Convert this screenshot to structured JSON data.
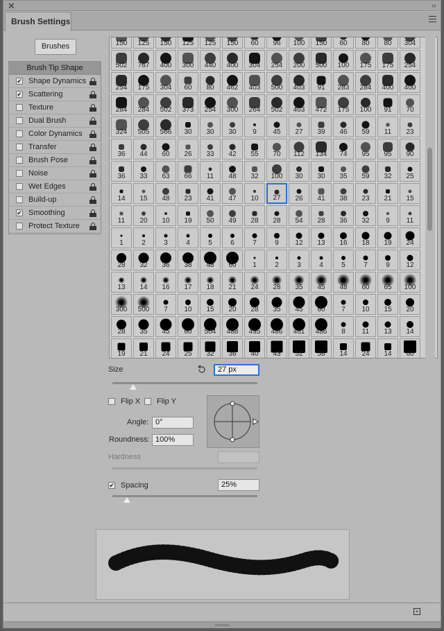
{
  "window": {
    "close_glyph": "✕",
    "collapse_glyph": "‹‹",
    "tab_title": "Brush Settings"
  },
  "left": {
    "brushes_button": "Brushes",
    "tip_shape": "Brush Tip Shape",
    "items": [
      {
        "label": "Shape Dynamics",
        "checked": true
      },
      {
        "label": "Scattering",
        "checked": true
      },
      {
        "label": "Texture",
        "checked": false
      },
      {
        "label": "Dual Brush",
        "checked": false
      },
      {
        "label": "Color Dynamics",
        "checked": false
      },
      {
        "label": "Transfer",
        "checked": false
      },
      {
        "label": "Brush Pose",
        "checked": false
      },
      {
        "label": "Noise",
        "checked": false
      },
      {
        "label": "Wet Edges",
        "checked": false
      },
      {
        "label": "Build-up",
        "checked": false
      },
      {
        "label": "Smoothing",
        "checked": true
      },
      {
        "label": "Protect Texture",
        "checked": false
      }
    ]
  },
  "presets": {
    "selected_row": 7,
    "selected_col": 7,
    "rows": [
      [
        "150",
        "125",
        "150",
        "125",
        "125",
        "150",
        "60",
        "96",
        "100",
        "150",
        "60",
        "80",
        "80",
        "304"
      ],
      [
        "502",
        "767",
        "400",
        "300",
        "440",
        "400",
        "304",
        "254",
        "200",
        "500",
        "100",
        "175",
        "175",
        "254"
      ],
      [
        "254",
        "175",
        "304",
        "60",
        "80",
        "462",
        "403",
        "500",
        "403",
        "91",
        "283",
        "284",
        "400",
        "400"
      ],
      [
        "284",
        "284",
        "502",
        "373",
        "254",
        "300",
        "264",
        "502",
        "403",
        "472",
        "175",
        "100",
        "91",
        "70"
      ],
      [
        "324",
        "505",
        "566",
        "30",
        "30",
        "30",
        "9",
        "45",
        "27",
        "39",
        "46",
        "59",
        "11",
        "23"
      ],
      [
        "36",
        "44",
        "60",
        "26",
        "33",
        "42",
        "55",
        "70",
        "112",
        "134",
        "74",
        "95",
        "95",
        "90"
      ],
      [
        "36",
        "33",
        "63",
        "66",
        "11",
        "48",
        "32",
        "100",
        "30",
        "30",
        "35",
        "59",
        "32",
        "25"
      ],
      [
        "14",
        "15",
        "48",
        "23",
        "41",
        "47",
        "10",
        "27",
        "26",
        "41",
        "38",
        "23",
        "21",
        "15"
      ],
      [
        "11",
        "20",
        "10",
        "19",
        "50",
        "49",
        "28",
        "28",
        "54",
        "28",
        "36",
        "32",
        "9",
        "11"
      ],
      [
        "1",
        "2",
        "3",
        "4",
        "5",
        "6",
        "7",
        "9",
        "12",
        "13",
        "16",
        "18",
        "19",
        "24"
      ],
      [
        "28",
        "32",
        "36",
        "38",
        "48",
        "60",
        "1",
        "2",
        "3",
        "4",
        "5",
        "7",
        "9",
        "12"
      ],
      [
        "13",
        "14",
        "16",
        "17",
        "18",
        "21",
        "24",
        "28",
        "35",
        "45",
        "48",
        "60",
        "65",
        "100"
      ],
      [
        "300",
        "500",
        "7",
        "10",
        "15",
        "20",
        "28",
        "35",
        "45",
        "60",
        "7",
        "10",
        "15",
        "20"
      ],
      [
        "28",
        "35",
        "45",
        "60",
        "504",
        "488",
        "495",
        "486",
        "461",
        "486",
        "8",
        "11",
        "13",
        "14"
      ],
      [
        "19",
        "21",
        "24",
        "25",
        "32",
        "36",
        "40",
        "43",
        "52",
        "58",
        "14",
        "24",
        "14",
        "60"
      ]
    ]
  },
  "controls": {
    "size_label": "Size",
    "size_value": "27 px",
    "size_fraction": 0.05,
    "flip_x": "Flip X",
    "flip_y": "Flip Y",
    "angle_label": "Angle:",
    "angle_value": "0°",
    "roundness_label": "Roundness:",
    "roundness_value": "100%",
    "hardness_label": "Hardness",
    "spacing_label": "Spacing",
    "spacing_value": "25%",
    "spacing_checked": true,
    "spacing_fraction": 0.1
  },
  "colors": {
    "accent": "#2f6fd1",
    "panel": "#b9b9b9"
  }
}
